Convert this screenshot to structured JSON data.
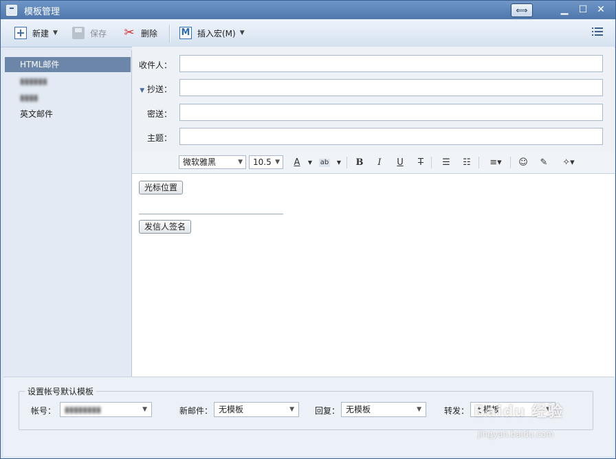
{
  "window": {
    "title": "模板管理"
  },
  "toolbar": {
    "new_label": "新建",
    "save_label": "保存",
    "delete_label": "删除",
    "insert_macro_label": "插入宏(M)"
  },
  "sidebar": {
    "items": [
      {
        "label": "HTML邮件",
        "selected": true
      },
      {
        "label": "▮▮▮▮▮▮",
        "blurred": true
      },
      {
        "label": "▮▮▮▮",
        "blurred": true
      },
      {
        "label": "英文邮件"
      }
    ]
  },
  "compose": {
    "to_label": "收件人：",
    "cc_label": "抄送：",
    "bcc_label": "密送：",
    "subject_label": "主题：",
    "to_value": "",
    "cc_value": "",
    "bcc_value": "",
    "subject_value": ""
  },
  "format": {
    "font": "微软雅黑",
    "size": "10.5"
  },
  "editor": {
    "cursor_button": "光标位置",
    "signature_button": "发信人签名"
  },
  "defaults": {
    "group_title": "设置帐号默认模板",
    "account_label": "帐号：",
    "account_value": "▮▮▮▮▮▮▮▮",
    "new_mail_label": "新邮件：",
    "new_mail_value": "无模板",
    "reply_label": "回复：",
    "reply_value": "无模板",
    "forward_label": "转发：",
    "forward_value": "无模板"
  },
  "watermark": {
    "logo": "Baidu 经验",
    "url": "jingyan.baidu.com"
  },
  "colors": {
    "title_bar": "#5b82b6",
    "sidebar_selected": "#6b86a8",
    "delete_icon": "#d72c2c"
  }
}
